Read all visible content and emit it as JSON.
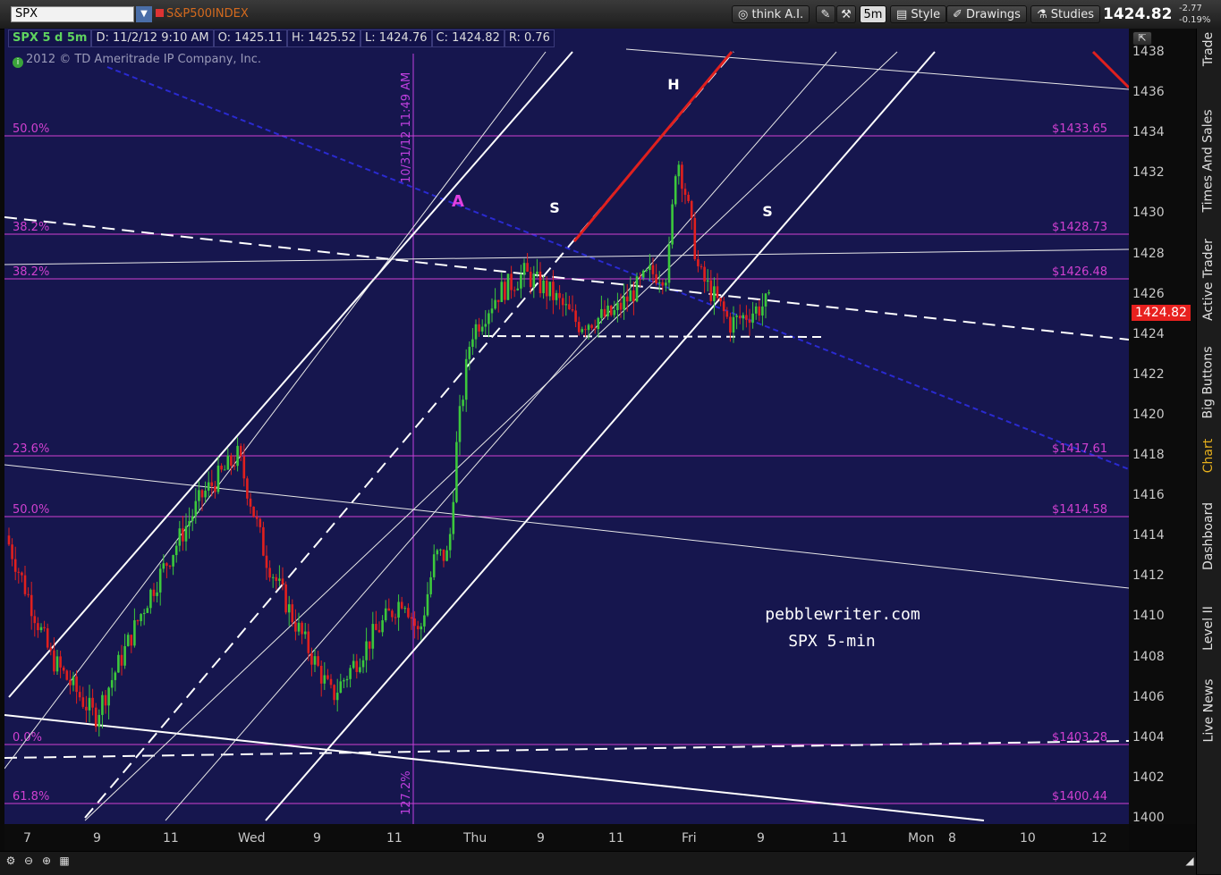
{
  "toolbar": {
    "symbol": "SPX",
    "symbol_desc": "S&P500INDEX",
    "think_ai": "think A.I.",
    "interval": "5m",
    "style": "Style",
    "drawings": "Drawings",
    "studies": "Studies",
    "last_price": "1424.82",
    "net_change": "-2.77",
    "pct_change": "-0.19%"
  },
  "info": {
    "symbol_period": "SPX 5 d 5m",
    "date": "D: 11/2/12 9:10 AM",
    "open": "O: 1425.11",
    "high": "H: 1425.52",
    "low": "L: 1424.76",
    "close": "C: 1424.82",
    "range": "R: 0.76",
    "copyright": "2012 © TD Ameritrade IP Company, Inc."
  },
  "y_axis": [
    "1438",
    "1436",
    "1434",
    "1432",
    "1430",
    "1428",
    "1426",
    "1424",
    "1422",
    "1420",
    "1418",
    "1416",
    "1414",
    "1412",
    "1410",
    "1408",
    "1406",
    "1404",
    "1402",
    "1400"
  ],
  "x_axis": [
    "7",
    "9",
    "11",
    "Wed",
    "9",
    "11",
    "Thu",
    "9",
    "11",
    "Fri",
    "9",
    "11",
    "Mon",
    "8",
    "10",
    "12"
  ],
  "price_tag": "1424.82",
  "fib_levels": [
    {
      "pct": "50.0%",
      "price": "$1433.65",
      "value": 1433.65
    },
    {
      "pct": "38.2%",
      "price": "$1428.73",
      "value": 1428.73
    },
    {
      "pct": "38.2%",
      "price": "$1426.48",
      "value": 1426.48
    },
    {
      "pct": "23.6%",
      "price": "$1417.61",
      "value": 1417.61
    },
    {
      "pct": "50.0%",
      "price": "$1414.58",
      "value": 1414.58
    },
    {
      "pct": "0.0%",
      "price": "$1403.28",
      "value": 1403.28
    },
    {
      "pct": "61.8%",
      "price": "$1400.44",
      "value": 1400.44
    }
  ],
  "vline_label": "10/31/12 11:49 AM",
  "vline_pct": "127.2%",
  "annotations": {
    "a": "A",
    "s1": "S",
    "h": "H",
    "s2": "S"
  },
  "watermark": {
    "site": "pebblewriter.com",
    "title": "SPX 5-min"
  },
  "side_tabs": [
    "Trade",
    "Times And Sales",
    "Active Trader",
    "Big Buttons",
    "Chart",
    "Dashboard",
    "Level II",
    "Live News"
  ],
  "colors": {
    "chart_bg": "#16164e",
    "up": "#3cc83c",
    "down": "#e0201e",
    "fib": "#d040d0",
    "price_tag": "#e8201e"
  }
}
